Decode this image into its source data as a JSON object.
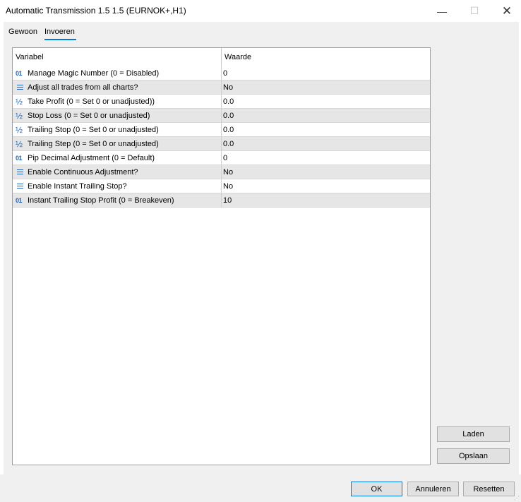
{
  "window": {
    "title": "Automatic Transmission 1.5 1.5 (EURNOK+,H1)",
    "minimize_glyph": "—",
    "maximize_glyph": "☐",
    "close_glyph": "✕"
  },
  "tabs": [
    {
      "label": "Gewoon",
      "active": false
    },
    {
      "label": "Invoeren",
      "active": true
    }
  ],
  "grid": {
    "columns": [
      "Variabel",
      "Waarde"
    ],
    "rows": [
      {
        "icon": "int-icon",
        "name": "Manage Magic Number (0 = Disabled)",
        "value": "0"
      },
      {
        "icon": "list-icon",
        "name": "Adjust all trades from all charts?",
        "value": "No"
      },
      {
        "icon": "double-icon",
        "name": "Take Profit (0 = Set 0 or unadjusted))",
        "value": "0.0"
      },
      {
        "icon": "double-icon",
        "name": "Stop Loss (0 = Set 0 or unadjusted)",
        "value": "0.0"
      },
      {
        "icon": "double-icon",
        "name": "Trailing Stop (0 = Set 0 or unadjusted)",
        "value": "0.0"
      },
      {
        "icon": "double-icon",
        "name": "Trailing Step (0 = Set 0 or unadjusted)",
        "value": "0.0"
      },
      {
        "icon": "int-icon",
        "name": "Pip Decimal Adjustment (0 = Default)",
        "value": "0"
      },
      {
        "icon": "list-icon",
        "name": "Enable Continuous Adjustment?",
        "value": "No"
      },
      {
        "icon": "list-icon",
        "name": "Enable Instant Trailing Stop?",
        "value": "No"
      },
      {
        "icon": "int-icon",
        "name": "Instant Trailing Stop Profit (0 = Breakeven)",
        "value": "10"
      }
    ]
  },
  "icons": {
    "int_glyph": "01",
    "double_glyph": "½"
  },
  "side_buttons": {
    "load": "Laden",
    "save": "Opslaan"
  },
  "footer_buttons": {
    "ok": "OK",
    "cancel": "Annuleren",
    "reset": "Resetten"
  },
  "colors": {
    "accent": "#0078d7",
    "icon": "#1a66c2",
    "alt_row": "#e6e6e6"
  }
}
